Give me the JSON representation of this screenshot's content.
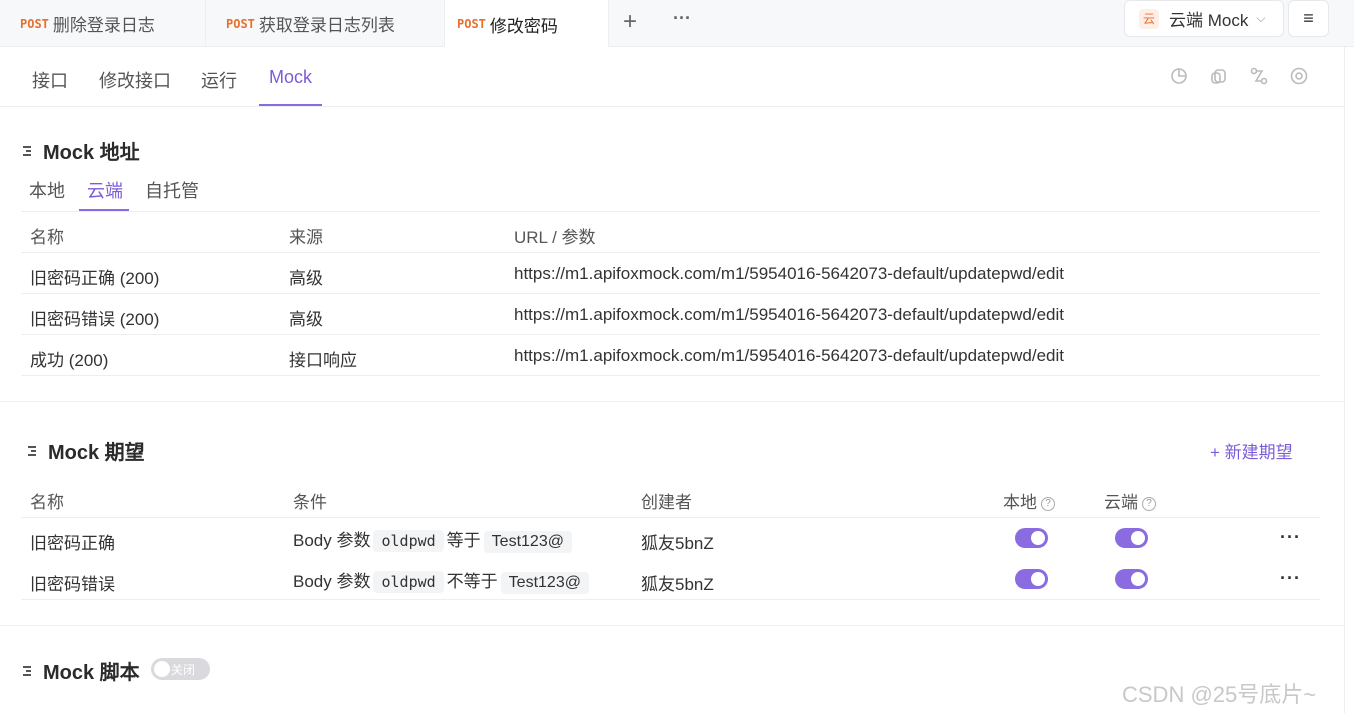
{
  "tabs": [
    {
      "method": "POST",
      "label": "删除登录日志"
    },
    {
      "method": "POST",
      "label": "获取登录日志列表"
    },
    {
      "method": "POST",
      "label": "修改密码",
      "active": true
    }
  ],
  "tabbar_actions": {
    "add_icon": "+",
    "more_icon": "···"
  },
  "environment": {
    "badge": "云",
    "label": "云端 Mock",
    "chevron": "⌵"
  },
  "menu_icon": "≡",
  "subnav": [
    "接口",
    "修改接口",
    "运行",
    "Mock"
  ],
  "subnav_active": "Mock",
  "toolbar_icons": [
    "chart-icon",
    "copy-icon",
    "share-icon",
    "settings-icon"
  ],
  "mock_address": {
    "title": "Mock 地址",
    "tabs": [
      "本地",
      "云端",
      "自托管"
    ],
    "active_tab": "云端",
    "columns": [
      "名称",
      "来源",
      "URL / 参数"
    ],
    "rows": [
      {
        "name": "旧密码正确 (200)",
        "source": "高级",
        "url": "https://m1.apifoxmock.com/m1/5954016-5642073-default/updatepwd/edit"
      },
      {
        "name": "旧密码错误 (200)",
        "source": "高级",
        "url": "https://m1.apifoxmock.com/m1/5954016-5642073-default/updatepwd/edit"
      },
      {
        "name": "成功 (200)",
        "source": "接口响应",
        "url": "https://m1.apifoxmock.com/m1/5954016-5642073-default/updatepwd/edit"
      }
    ]
  },
  "mock_expect": {
    "title": "Mock 期望",
    "new_button": "+ 新建期望",
    "columns": [
      "名称",
      "条件",
      "创建者",
      "本地",
      "云端"
    ],
    "help_icon": "?",
    "rows": [
      {
        "name": "旧密码正确",
        "cond_prefix": "Body 参数",
        "cond_param": "oldpwd",
        "cond_op": "等于",
        "cond_value": "Test123@",
        "creator": "狐友5bnZ",
        "local": true,
        "cloud": true,
        "more": "···"
      },
      {
        "name": "旧密码错误",
        "cond_prefix": "Body 参数",
        "cond_param": "oldpwd",
        "cond_op": "不等于",
        "cond_value": "Test123@",
        "creator": "狐友5bnZ",
        "local": true,
        "cloud": true,
        "more": "···"
      }
    ]
  },
  "mock_script": {
    "title": "Mock 脚本",
    "toggle_label": "关闭",
    "enabled": false
  },
  "watermark": "CSDN @25号底片~"
}
